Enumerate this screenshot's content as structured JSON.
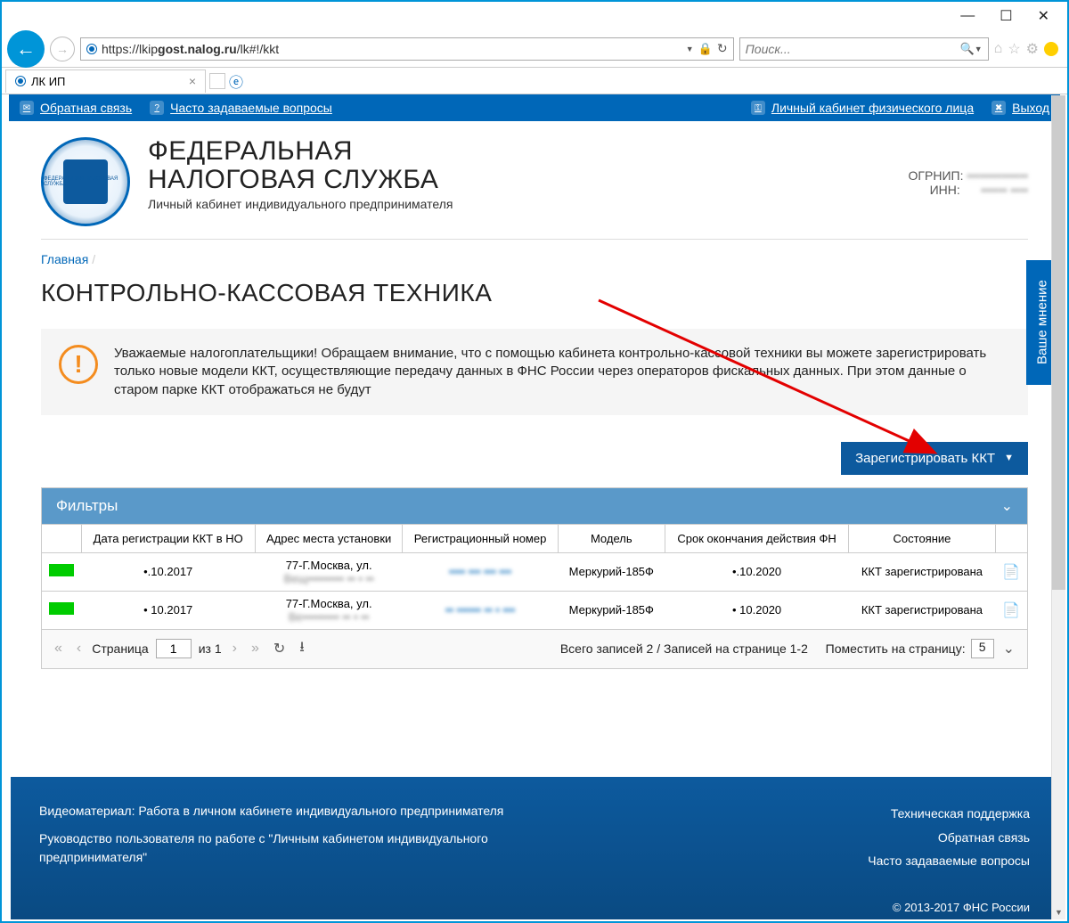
{
  "browser": {
    "url_prefix": "https://lkip",
    "url_bold": "gost.nalog.ru",
    "url_suffix": "/lk#!/kkt",
    "search_placeholder": "Поиск...",
    "tab_title": "ЛК ИП"
  },
  "navbar": {
    "feedback": "Обратная связь",
    "faq": "Часто задаваемые вопросы",
    "personal": "Личный кабинет физического лица",
    "exit": "Выход"
  },
  "header": {
    "line1": "ФЕДЕРАЛЬНАЯ",
    "line2": "НАЛОГОВАЯ СЛУЖБА",
    "subtitle": "Личный кабинет индивидуального предпринимателя",
    "ogrnip_label": "ОГРНИП:",
    "ogrnip_value": "••••••••••••••",
    "inn_label": "ИНН:",
    "inn_value": "•••••• ••••"
  },
  "breadcrumb": {
    "home": "Главная"
  },
  "page_title": "КОНТРОЛЬНО-КАССОВАЯ ТЕХНИКА",
  "notice": "Уважаемые налогоплательщики! Обращаем внимание, что с помощью кабинета контрольно-кассовой техники вы можете зарегистрировать только новые модели ККТ, осуществляющие передачу данных в ФНС России через операторов фискальных данных. При этом данные о старом парке ККТ отображаться не будут",
  "register_button": "Зарегистрировать ККТ",
  "filters_label": "Фильтры",
  "table": {
    "columns": [
      "",
      "Дата регистрации ККТ в НО",
      "Адрес места установки",
      "Регистрационный номер",
      "Модель",
      "Срок окончания действия ФН",
      "Состояние",
      ""
    ],
    "rows": [
      {
        "date": "•.10.2017",
        "addr1": "77-Г.Москва, ул.",
        "addr2": "Вещ••••••••• •• • ••",
        "regnum": "•••• ••• ••• •••",
        "model": "Меркурий-185Ф",
        "expiry": "•.10.2020",
        "state": "ККТ зарегистрирована"
      },
      {
        "date": "• 10.2017",
        "addr1": "77-Г.Москва, ул.",
        "addr2": "Ве••••••••• •• • ••",
        "regnum": "•• •••••• •• • •••",
        "model": "Меркурий-185Ф",
        "expiry": "• 10.2020",
        "state": "ККТ зарегистрирована"
      }
    ]
  },
  "pagination": {
    "page_label": "Страница",
    "page_value": "1",
    "of_label": "из 1",
    "summary": "Всего записей 2 / Записей на странице 1-2",
    "per_page_label": "Поместить на страницу:",
    "per_page_value": "5"
  },
  "footer": {
    "left1": "Видеоматериал: Работа в личном кабинете индивидуального предпринимателя",
    "left2": "Руководство пользователя по работе с \"Личным кабинетом индивидуального предпринимателя\"",
    "right1": "Техническая поддержка",
    "right2": "Обратная связь",
    "right3": "Часто задаваемые вопросы",
    "copyright": "© 2013-2017 ФНС России"
  },
  "feedback_tab": "Ваше мнение"
}
